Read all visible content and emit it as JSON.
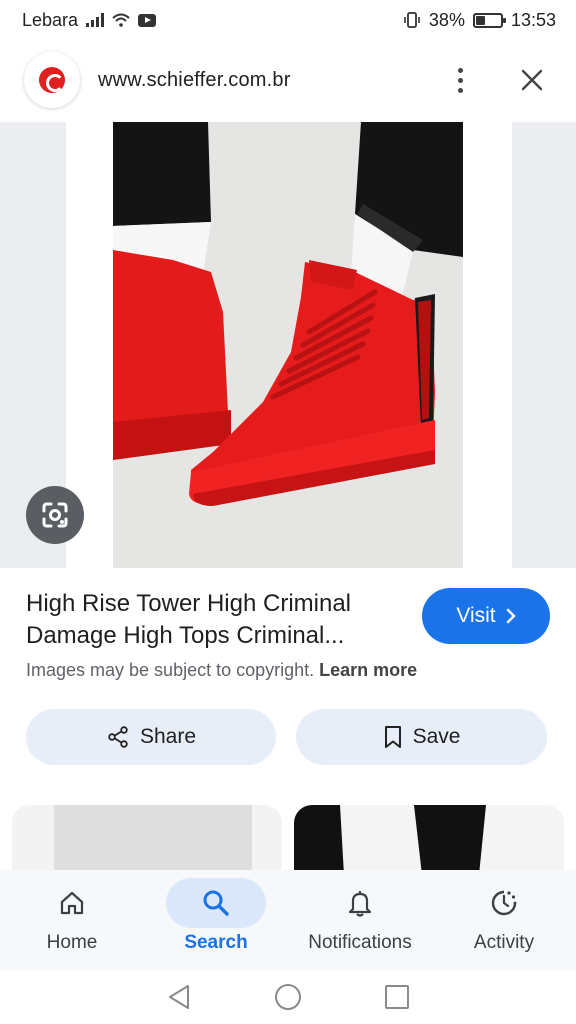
{
  "status_bar": {
    "carrier": "Lebara",
    "battery": "38%",
    "time": "13:53",
    "battery_level": 0.38
  },
  "browser": {
    "url": "www.schieffer.com.br"
  },
  "result": {
    "title_line1": "High Rise Tower High Criminal",
    "title_line2": "Damage High Tops Criminal...",
    "visit_label": "Visit",
    "copyright_text": "Images may be subject to copyright.",
    "learn_more": "Learn more"
  },
  "actions": {
    "share_label": "Share",
    "save_label": "Save"
  },
  "bottom_nav": {
    "items": [
      {
        "label": "Home",
        "icon": "home-icon"
      },
      {
        "label": "Search",
        "icon": "search-icon",
        "active": true
      },
      {
        "label": "Notifications",
        "icon": "bell-icon"
      },
      {
        "label": "Activity",
        "icon": "activity-icon"
      }
    ]
  },
  "colors": {
    "accent": "#1a73e8",
    "pill_bg": "#e8eef8",
    "shoe_red": "#e81e1e"
  }
}
